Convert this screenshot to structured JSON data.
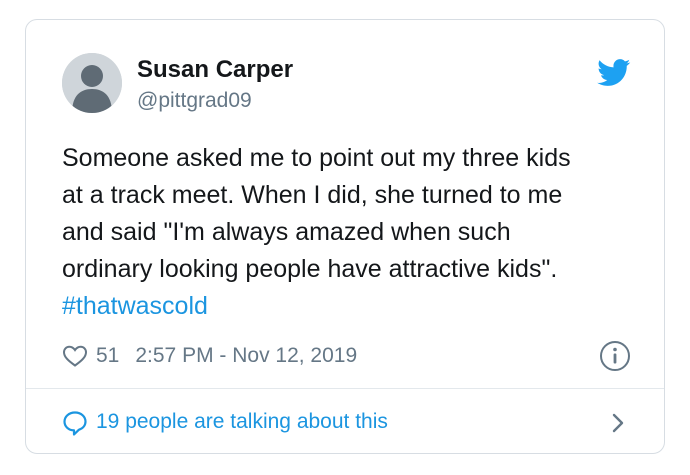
{
  "tweet": {
    "author": {
      "name": "Susan Carper",
      "handle": "@pittgrad09"
    },
    "text_lines": [
      "Someone asked me to point out my three kids",
      "at a track meet.  When I did, she turned to me",
      "and said \"I'm always amazed when such",
      "ordinary looking people have attractive kids\"."
    ],
    "hashtag": "#thatwascold",
    "likes": "51",
    "timestamp": "2:57 PM - Nov 12, 2019",
    "talking_label": "19 people are talking about this"
  },
  "colors": {
    "brand": "#1da1f2",
    "link": "#1b95e0",
    "muted": "#657786",
    "text": "#14171a"
  },
  "icons": [
    "avatar-placeholder-icon",
    "twitter-bird-icon",
    "heart-icon",
    "info-icon",
    "speech-bubble-icon",
    "chevron-right-icon"
  ]
}
